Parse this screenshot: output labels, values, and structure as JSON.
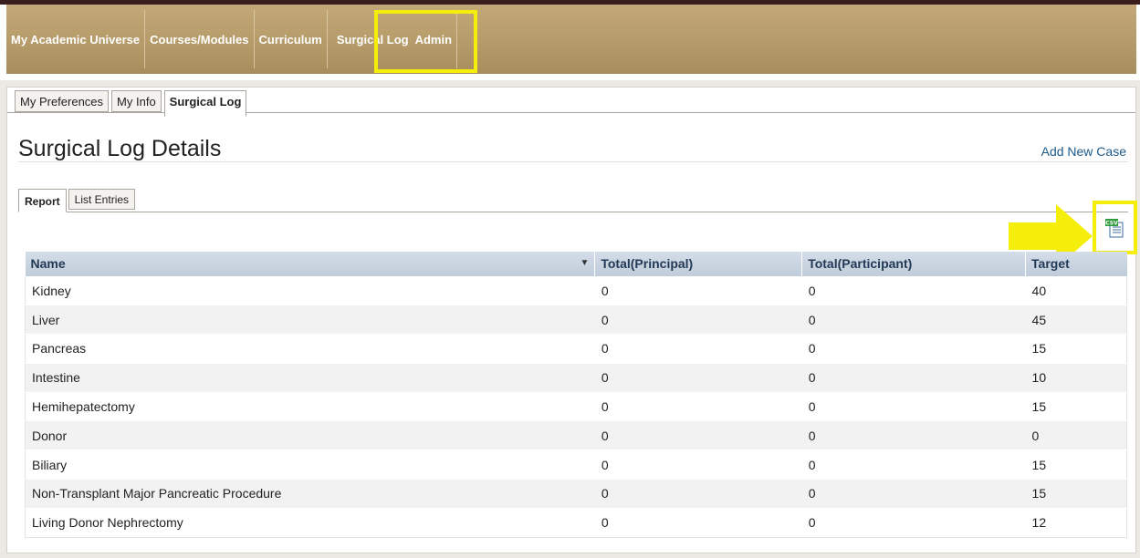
{
  "nav": {
    "items": [
      {
        "label": "My Academic Universe"
      },
      {
        "label": "Courses/Modules"
      },
      {
        "label": "Curriculum"
      },
      {
        "label": "Surgical Log"
      },
      {
        "label": "Admin"
      }
    ]
  },
  "subtabs": [
    {
      "label": "My Preferences"
    },
    {
      "label": "My Info"
    },
    {
      "label": "Surgical Log"
    }
  ],
  "page": {
    "title": "Surgical Log Details",
    "add_link": "Add New Case"
  },
  "report_tabs": [
    {
      "label": "Report"
    },
    {
      "label": "List Entries"
    }
  ],
  "export": {
    "icon": "csv-export-icon",
    "icon_text": "CSV"
  },
  "table": {
    "headers": [
      "Name",
      "Total(Principal)",
      "Total(Participant)",
      "Target"
    ],
    "rows": [
      [
        "Kidney",
        "0",
        "0",
        "40"
      ],
      [
        "Liver",
        "0",
        "0",
        "45"
      ],
      [
        "Pancreas",
        "0",
        "0",
        "15"
      ],
      [
        "Intestine",
        "0",
        "0",
        "10"
      ],
      [
        "Hemihepatectomy",
        "0",
        "0",
        "15"
      ],
      [
        "Donor",
        "0",
        "0",
        "0"
      ],
      [
        "Biliary",
        "0",
        "0",
        "15"
      ],
      [
        "Non-Transplant Major Pancreatic Procedure",
        "0",
        "0",
        "15"
      ],
      [
        "Living Donor Nephrectomy",
        "0",
        "0",
        "12"
      ]
    ]
  },
  "colors": {
    "nav_bg": "#b89e6c",
    "highlight": "#f5ee0a",
    "link": "#1c5a8a",
    "header_text": "#233a56"
  }
}
